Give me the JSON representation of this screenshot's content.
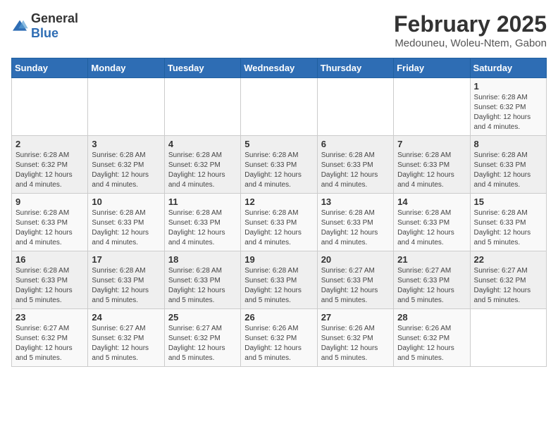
{
  "header": {
    "logo_general": "General",
    "logo_blue": "Blue",
    "title": "February 2025",
    "subtitle": "Medouneu, Woleu-Ntem, Gabon"
  },
  "days_of_week": [
    "Sunday",
    "Monday",
    "Tuesday",
    "Wednesday",
    "Thursday",
    "Friday",
    "Saturday"
  ],
  "weeks": [
    [
      {
        "day": "",
        "info": ""
      },
      {
        "day": "",
        "info": ""
      },
      {
        "day": "",
        "info": ""
      },
      {
        "day": "",
        "info": ""
      },
      {
        "day": "",
        "info": ""
      },
      {
        "day": "",
        "info": ""
      },
      {
        "day": "1",
        "info": "Sunrise: 6:28 AM\nSunset: 6:32 PM\nDaylight: 12 hours and 4 minutes."
      }
    ],
    [
      {
        "day": "2",
        "info": "Sunrise: 6:28 AM\nSunset: 6:32 PM\nDaylight: 12 hours and 4 minutes."
      },
      {
        "day": "3",
        "info": "Sunrise: 6:28 AM\nSunset: 6:32 PM\nDaylight: 12 hours and 4 minutes."
      },
      {
        "day": "4",
        "info": "Sunrise: 6:28 AM\nSunset: 6:32 PM\nDaylight: 12 hours and 4 minutes."
      },
      {
        "day": "5",
        "info": "Sunrise: 6:28 AM\nSunset: 6:33 PM\nDaylight: 12 hours and 4 minutes."
      },
      {
        "day": "6",
        "info": "Sunrise: 6:28 AM\nSunset: 6:33 PM\nDaylight: 12 hours and 4 minutes."
      },
      {
        "day": "7",
        "info": "Sunrise: 6:28 AM\nSunset: 6:33 PM\nDaylight: 12 hours and 4 minutes."
      },
      {
        "day": "8",
        "info": "Sunrise: 6:28 AM\nSunset: 6:33 PM\nDaylight: 12 hours and 4 minutes."
      }
    ],
    [
      {
        "day": "9",
        "info": "Sunrise: 6:28 AM\nSunset: 6:33 PM\nDaylight: 12 hours and 4 minutes."
      },
      {
        "day": "10",
        "info": "Sunrise: 6:28 AM\nSunset: 6:33 PM\nDaylight: 12 hours and 4 minutes."
      },
      {
        "day": "11",
        "info": "Sunrise: 6:28 AM\nSunset: 6:33 PM\nDaylight: 12 hours and 4 minutes."
      },
      {
        "day": "12",
        "info": "Sunrise: 6:28 AM\nSunset: 6:33 PM\nDaylight: 12 hours and 4 minutes."
      },
      {
        "day": "13",
        "info": "Sunrise: 6:28 AM\nSunset: 6:33 PM\nDaylight: 12 hours and 4 minutes."
      },
      {
        "day": "14",
        "info": "Sunrise: 6:28 AM\nSunset: 6:33 PM\nDaylight: 12 hours and 4 minutes."
      },
      {
        "day": "15",
        "info": "Sunrise: 6:28 AM\nSunset: 6:33 PM\nDaylight: 12 hours and 5 minutes."
      }
    ],
    [
      {
        "day": "16",
        "info": "Sunrise: 6:28 AM\nSunset: 6:33 PM\nDaylight: 12 hours and 5 minutes."
      },
      {
        "day": "17",
        "info": "Sunrise: 6:28 AM\nSunset: 6:33 PM\nDaylight: 12 hours and 5 minutes."
      },
      {
        "day": "18",
        "info": "Sunrise: 6:28 AM\nSunset: 6:33 PM\nDaylight: 12 hours and 5 minutes."
      },
      {
        "day": "19",
        "info": "Sunrise: 6:28 AM\nSunset: 6:33 PM\nDaylight: 12 hours and 5 minutes."
      },
      {
        "day": "20",
        "info": "Sunrise: 6:27 AM\nSunset: 6:33 PM\nDaylight: 12 hours and 5 minutes."
      },
      {
        "day": "21",
        "info": "Sunrise: 6:27 AM\nSunset: 6:33 PM\nDaylight: 12 hours and 5 minutes."
      },
      {
        "day": "22",
        "info": "Sunrise: 6:27 AM\nSunset: 6:32 PM\nDaylight: 12 hours and 5 minutes."
      }
    ],
    [
      {
        "day": "23",
        "info": "Sunrise: 6:27 AM\nSunset: 6:32 PM\nDaylight: 12 hours and 5 minutes."
      },
      {
        "day": "24",
        "info": "Sunrise: 6:27 AM\nSunset: 6:32 PM\nDaylight: 12 hours and 5 minutes."
      },
      {
        "day": "25",
        "info": "Sunrise: 6:27 AM\nSunset: 6:32 PM\nDaylight: 12 hours and 5 minutes."
      },
      {
        "day": "26",
        "info": "Sunrise: 6:26 AM\nSunset: 6:32 PM\nDaylight: 12 hours and 5 minutes."
      },
      {
        "day": "27",
        "info": "Sunrise: 6:26 AM\nSunset: 6:32 PM\nDaylight: 12 hours and 5 minutes."
      },
      {
        "day": "28",
        "info": "Sunrise: 6:26 AM\nSunset: 6:32 PM\nDaylight: 12 hours and 5 minutes."
      },
      {
        "day": "",
        "info": ""
      }
    ]
  ]
}
